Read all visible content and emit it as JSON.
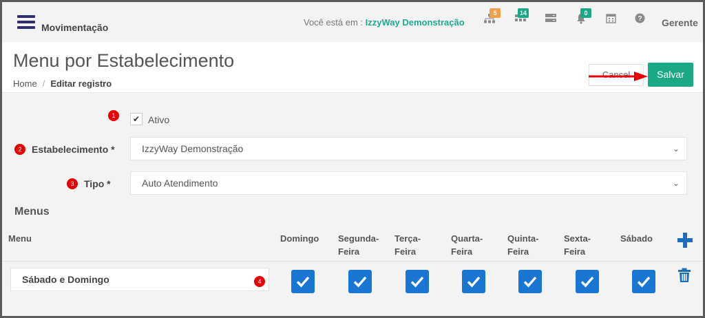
{
  "topbar": {
    "module_title": "Movimentação",
    "location_prefix": "Você está em :",
    "location_company": "IzzyWay Demonstração",
    "badges": {
      "org": "5",
      "grid": "14",
      "bell": "0"
    },
    "badge_colors": {
      "org": "#f0a04b",
      "grid": "#1aa887",
      "bell": "#1aa887"
    },
    "user_role": "Gerente"
  },
  "header": {
    "title": "Menu por Estabelecimento",
    "breadcrumb_home": "Home",
    "breadcrumb_sep": "/",
    "breadcrumb_current": "Editar registro",
    "cancel_label": "Cancel",
    "save_label": "Salvar"
  },
  "form": {
    "markers": [
      "1",
      "2",
      "3",
      "4"
    ],
    "ativo_label": "Ativo",
    "ativo_checked": true,
    "estabelecimento_label": "Estabelecimento *",
    "estabelecimento_value": "IzzyWay Demonstração",
    "tipo_label": "Tipo *",
    "tipo_value": "Auto Atendimento"
  },
  "menus": {
    "section_title": "Menus",
    "col_menu": "Menu",
    "days": [
      {
        "line1": "Domingo",
        "line2": ""
      },
      {
        "line1": "Segunda-",
        "line2": "Feira"
      },
      {
        "line1": "Terça-",
        "line2": "Feira"
      },
      {
        "line1": "Quarta-",
        "line2": "Feira"
      },
      {
        "line1": "Quinta-",
        "line2": "Feira"
      },
      {
        "line1": "Sexta-",
        "line2": "Feira"
      },
      {
        "line1": "Sábado",
        "line2": ""
      }
    ],
    "rows": [
      {
        "menu": "Sábado e Domingo",
        "checked": [
          true,
          true,
          true,
          true,
          true,
          true,
          true
        ]
      }
    ]
  },
  "colors": {
    "accent_green": "#1aa887",
    "checkbox_blue": "#1976d2",
    "marker_red": "#e60000",
    "arrow_red": "#e60000",
    "action_blue": "#1f6fb8"
  }
}
